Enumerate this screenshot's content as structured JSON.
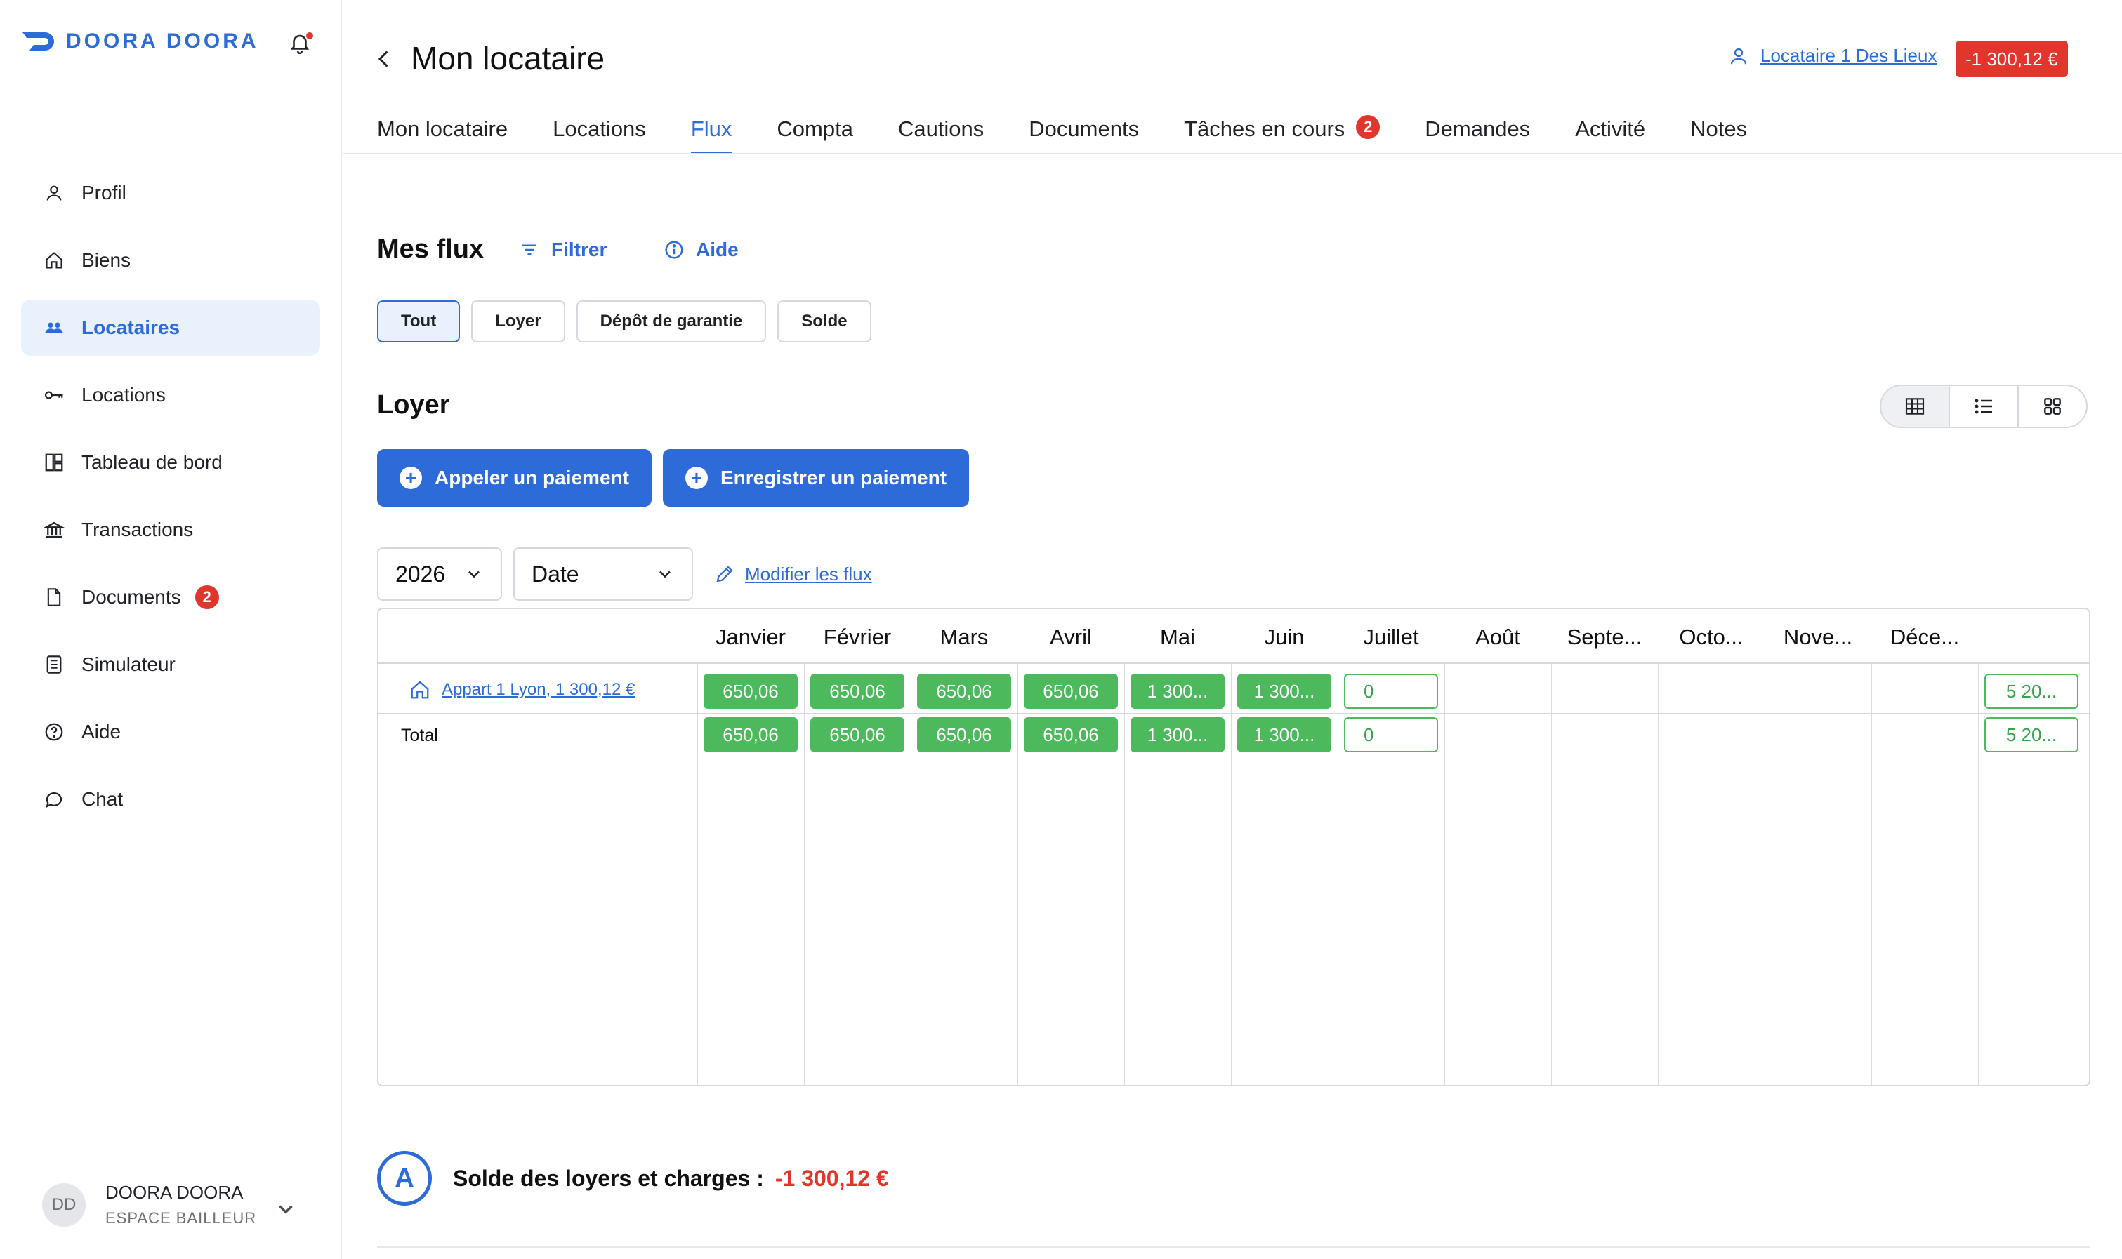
{
  "brand": {
    "name": "DOORA DOORA",
    "color": "#2d6bd8"
  },
  "sidebar": {
    "items": [
      {
        "label": "Profil",
        "icon": "user-icon"
      },
      {
        "label": "Biens",
        "icon": "home-icon"
      },
      {
        "label": "Locataires",
        "icon": "users-icon",
        "active": true
      },
      {
        "label": "Locations",
        "icon": "key-icon"
      },
      {
        "label": "Tableau de bord",
        "icon": "dashboard-icon"
      },
      {
        "label": "Transactions",
        "icon": "bank-icon"
      },
      {
        "label": "Documents",
        "icon": "document-icon",
        "badge": "2"
      },
      {
        "label": "Simulateur",
        "icon": "calculator-icon"
      },
      {
        "label": "Aide",
        "icon": "help-icon"
      },
      {
        "label": "Chat",
        "icon": "chat-icon"
      }
    ],
    "user": {
      "initials": "DD",
      "name": "DOORA DOORA",
      "role": "ESPACE BAILLEUR"
    }
  },
  "header": {
    "title": "Mon locataire",
    "tenant_link": "Locataire 1 Des Lieux",
    "balance": "-1 300,12 €"
  },
  "tabs": [
    {
      "label": "Mon locataire"
    },
    {
      "label": "Locations"
    },
    {
      "label": "Flux",
      "active": true
    },
    {
      "label": "Compta"
    },
    {
      "label": "Cautions"
    },
    {
      "label": "Documents"
    },
    {
      "label": "Tâches en cours",
      "badge": "2"
    },
    {
      "label": "Demandes"
    },
    {
      "label": "Activité"
    },
    {
      "label": "Notes"
    }
  ],
  "flux": {
    "title": "Mes flux",
    "filter_label": "Filtrer",
    "help_label": "Aide",
    "chips": [
      {
        "label": "Tout",
        "active": true
      },
      {
        "label": "Loyer"
      },
      {
        "label": "Dépôt de garantie"
      },
      {
        "label": "Solde"
      }
    ]
  },
  "loyer": {
    "title": "Loyer",
    "view_modes": [
      "grid-icon",
      "list-icon",
      "tiles-icon"
    ],
    "actions": {
      "call_payment": "Appeler un paiement",
      "record_payment": "Enregistrer un paiement"
    },
    "year": "2026",
    "sort": "Date",
    "edit_link": "Modifier les flux"
  },
  "table": {
    "months": [
      "Janvier",
      "Février",
      "Mars",
      "Avril",
      "Mai",
      "Juin",
      "Juillet",
      "Août",
      "Septe...",
      "Octo...",
      "Nove...",
      "Déce..."
    ],
    "rows": [
      {
        "label": "Appart 1 Lyon, 1 300,12 €",
        "values": [
          "650,06",
          "650,06",
          "650,06",
          "650,06",
          "1 300...",
          "1 300...",
          "0",
          "",
          "",
          "",
          "",
          ""
        ],
        "total": "5 20..."
      },
      {
        "label": "Total",
        "values": [
          "650,06",
          "650,06",
          "650,06",
          "650,06",
          "1 300...",
          "1 300...",
          "0",
          "",
          "",
          "",
          "",
          ""
        ],
        "total": "5 20..."
      }
    ],
    "paid_color": "#4cba5c"
  },
  "solde": {
    "letter": "A",
    "label": "Solde des loyers et charges :",
    "value": "-1 300,12 €",
    "value_color": "#e0362c"
  }
}
